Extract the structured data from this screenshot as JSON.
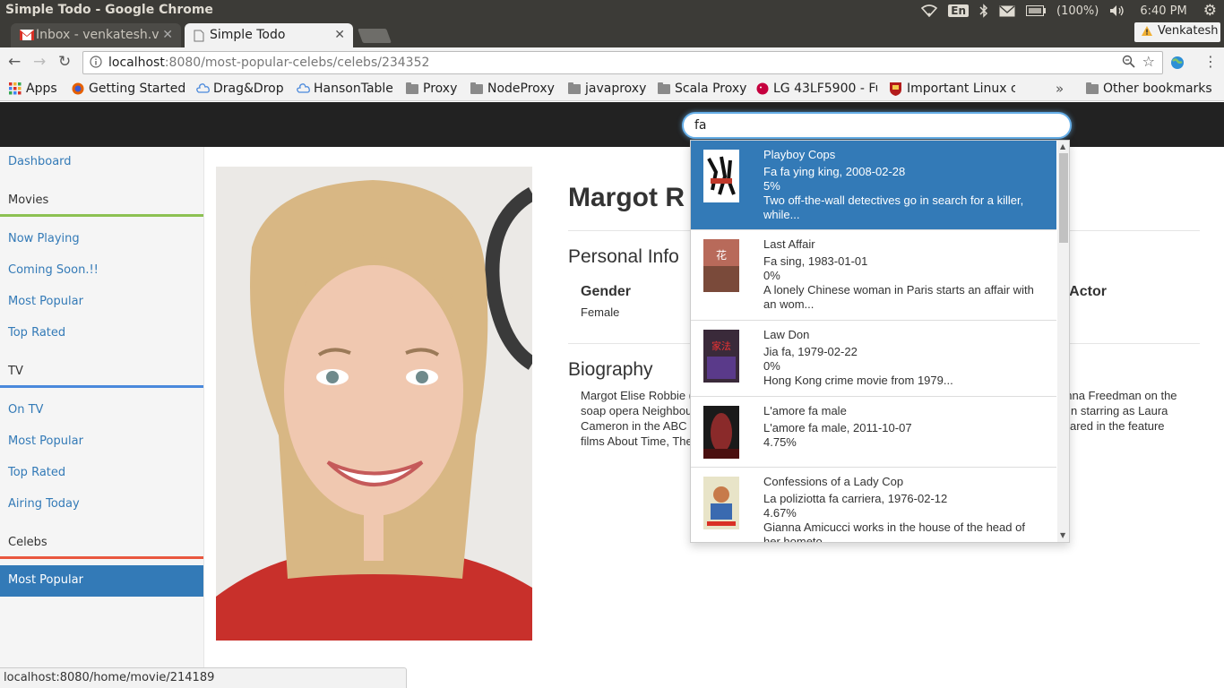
{
  "os": {
    "window_title": "Simple Todo - Google Chrome",
    "keyboard": "En",
    "battery": "(100%)",
    "time": "6:40 PM"
  },
  "tabs": [
    {
      "label": "Inbox - venkatesh.v",
      "active": false
    },
    {
      "label": "Simple Todo",
      "active": true
    }
  ],
  "profile": {
    "name": "Venkatesh"
  },
  "address": {
    "host": "localhost",
    "path": ":8080/most-popular-celebs/celebs/234352"
  },
  "bookmarks": [
    {
      "label": "Apps",
      "icon": "apps-icon"
    },
    {
      "label": "Getting Started",
      "icon": "firefox-icon"
    },
    {
      "label": "Drag&Drop",
      "icon": "cloud-icon"
    },
    {
      "label": "HansonTable",
      "icon": "cloud-icon"
    },
    {
      "label": "Proxy",
      "icon": "folder-icon"
    },
    {
      "label": "NodeProxy",
      "icon": "folder-icon"
    },
    {
      "label": "javaproxy",
      "icon": "folder-icon"
    },
    {
      "label": "Scala Proxy",
      "icon": "folder-icon"
    },
    {
      "label": "LG 43LF5900 - Ful",
      "icon": "lg-icon"
    },
    {
      "label": "Important Linux c",
      "icon": "shield-icon"
    },
    {
      "label": "Other bookmarks",
      "icon": "folder-icon"
    }
  ],
  "search": {
    "value": "fa"
  },
  "sidebar": {
    "dashboard": "Dashboard",
    "movies_header": "Movies",
    "movies": [
      "Now Playing",
      "Coming Soon.!!",
      "Most Popular",
      "Top Rated"
    ],
    "tv_header": "TV",
    "tv": [
      "On TV",
      "Most Popular",
      "Top Rated",
      "Airing Today"
    ],
    "celebs_header": "Celebs",
    "celebs": [
      "Most Popular"
    ],
    "colors": {
      "movies": "#8cc152",
      "tv": "#4a89dc",
      "celebs": "#e9573f"
    }
  },
  "celeb": {
    "name": "Margot Robbie",
    "name_visible": "Margot R",
    "personal_info_title": "Personal Info",
    "gender_label": "Gender",
    "gender_value": "Female",
    "known_for_label_visible": "t Actor",
    "biography_title": "Biography",
    "bio_lines_left": [
      "Margot Elise Robbie (",
      "soap opera Neighbou",
      "Cameron in the ABC",
      "films About Time, The"
    ],
    "bio_lines_right": [
      "onna Freedman on the",
      "n starring as Laura",
      "ared in the feature"
    ]
  },
  "suggestions": [
    {
      "title": "Playboy Cops",
      "subtitle": "Fa fa ying king, 2008-02-28",
      "rating": "5%",
      "overview": "Two off-the-wall detectives go in search for a killer, while...",
      "active": true
    },
    {
      "title": "Last Affair",
      "subtitle": "Fa sing, 1983-01-01",
      "rating": "0%",
      "overview": "A lonely Chinese woman in Paris starts an affair with an wom...",
      "active": false
    },
    {
      "title": "Law Don",
      "subtitle": "Jia fa, 1979-02-22",
      "rating": "0%",
      "overview": "Hong Kong crime movie from 1979...",
      "active": false
    },
    {
      "title": "L'amore fa male",
      "subtitle": "L'amore fa male, 2011-10-07",
      "rating": "4.75%",
      "overview": "",
      "active": false
    },
    {
      "title": "Confessions of a Lady Cop",
      "subtitle": "La poliziotta fa carriera, 1976-02-12",
      "rating": "4.67%",
      "overview": "Gianna Amicucci works in the house of the head of her hometo...",
      "active": false
    }
  ],
  "status_bar": {
    "url": "localhost:8080/home/movie/214189"
  }
}
